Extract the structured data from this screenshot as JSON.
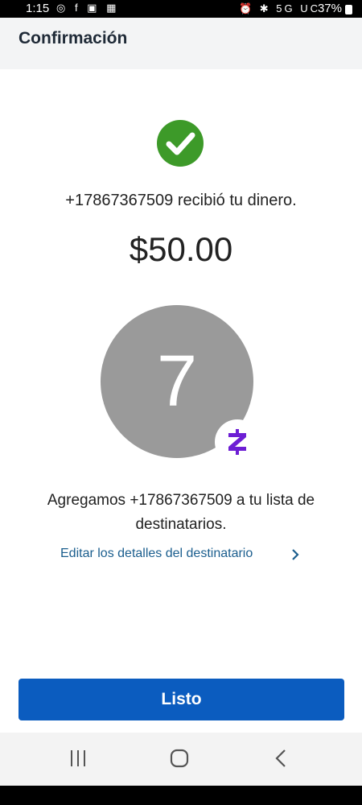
{
  "status_bar": {
    "time": "1:15",
    "left_icons": "◎ f ▣ ▦",
    "right_icons": "⏰ ✱ 5G UC",
    "battery": "37%"
  },
  "header": {
    "title": "Confirmación"
  },
  "confirmation": {
    "received_text": "+17867367509 recibió tu dinero.",
    "amount": "$50.00"
  },
  "recipient": {
    "initial": "7",
    "added_text": "Agregamos +17867367509 a tu lista de destinatarios.",
    "edit_link": "Editar los detalles del destinatario"
  },
  "actions": {
    "done_label": "Listo"
  },
  "colors": {
    "success_green": "#3d9a29",
    "primary_blue": "#0b5cbf",
    "zelle_purple": "#6d1ed4",
    "avatar_gray": "#9a9a9a"
  },
  "icons": [
    "check-icon",
    "zelle-icon",
    "chevron-right-icon",
    "recent-apps-icon",
    "home-icon",
    "back-icon"
  ]
}
